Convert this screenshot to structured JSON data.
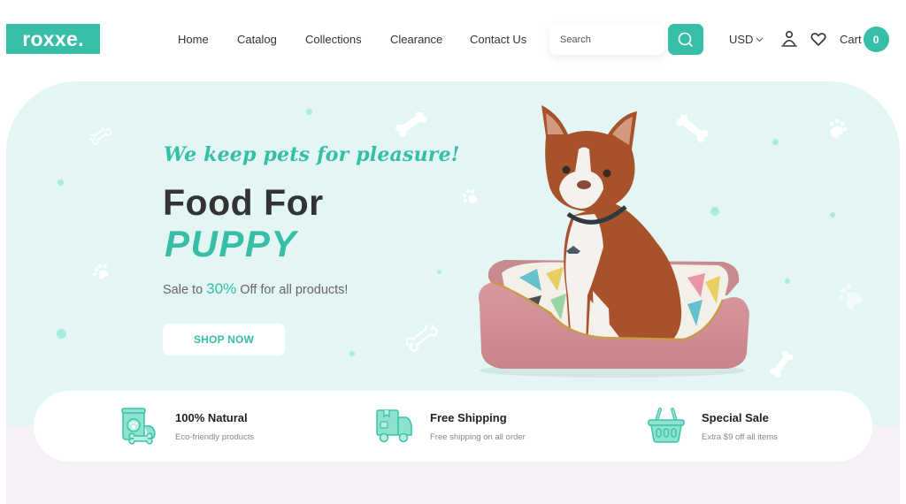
{
  "header": {
    "logo": "roxxe.",
    "nav": [
      {
        "label": "Home"
      },
      {
        "label": "Catalog"
      },
      {
        "label": "Collections"
      },
      {
        "label": "Clearance"
      },
      {
        "label": "Contact Us"
      }
    ],
    "search": {
      "placeholder": "Search",
      "value": "",
      "button_icon": "search-icon"
    },
    "currency": {
      "selected": "USD",
      "icon": "chevron-down-icon"
    },
    "account_icon": "user-icon",
    "wishlist_icon": "heart-icon",
    "cart": {
      "label": "Cart",
      "count": "0"
    }
  },
  "hero": {
    "tagline": "We keep pets for pleasure!",
    "title_line1": "Food For",
    "title_line2": "PUPPY",
    "sale_prefix": "Sale to ",
    "sale_percent": "30%",
    "sale_suffix": " Off for all products!",
    "cta": "SHOP NOW",
    "image": "boston-terrier-in-pink-dog-bed"
  },
  "features": [
    {
      "icon": "pet-food-can-icon",
      "title": "100% Natural",
      "subtitle": "Eco-friendly products"
    },
    {
      "icon": "delivery-truck-icon",
      "title": "Free Shipping",
      "subtitle": "Free shipping on all order"
    },
    {
      "icon": "shopping-basket-icon",
      "title": "Special Sale",
      "subtitle": "Extra $9 off all items"
    }
  ],
  "colors": {
    "accent": "#36bea7",
    "hero_bg": "#e3f6f4",
    "lower_bg": "#f6f1f8",
    "text_dark": "#333333"
  }
}
